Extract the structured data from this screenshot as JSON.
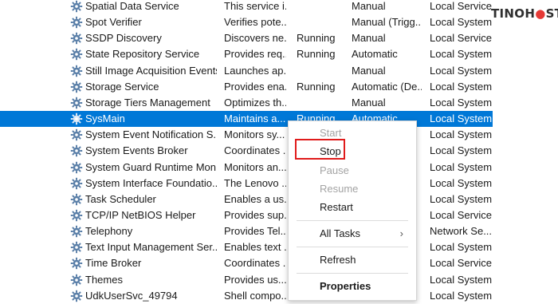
{
  "services": [
    {
      "name": "Spatial Data Service",
      "description": "This service i...",
      "status": "",
      "startup": "Manual",
      "logon": "Local Service"
    },
    {
      "name": "Spot Verifier",
      "description": "Verifies pote...",
      "status": "",
      "startup": "Manual (Trigg...",
      "logon": "Local System"
    },
    {
      "name": "SSDP Discovery",
      "description": "Discovers ne...",
      "status": "Running",
      "startup": "Manual",
      "logon": "Local Service"
    },
    {
      "name": "State Repository Service",
      "description": "Provides req...",
      "status": "Running",
      "startup": "Automatic",
      "logon": "Local System"
    },
    {
      "name": "Still Image Acquisition Events",
      "description": "Launches ap...",
      "status": "",
      "startup": "Manual",
      "logon": "Local System"
    },
    {
      "name": "Storage Service",
      "description": "Provides ena...",
      "status": "Running",
      "startup": "Automatic (De...",
      "logon": "Local System"
    },
    {
      "name": "Storage Tiers Management",
      "description": "Optimizes th...",
      "status": "",
      "startup": "Manual",
      "logon": "Local System"
    },
    {
      "name": "SysMain",
      "description": "Maintains a...",
      "status": "Running",
      "startup": "Automatic",
      "logon": "Local System",
      "selected": true
    },
    {
      "name": "System Event Notification S...",
      "description": "Monitors sy...",
      "status": "",
      "startup": "",
      "logon": "Local System"
    },
    {
      "name": "System Events Broker",
      "description": "Coordinates ...",
      "status": "",
      "startup": "",
      "logon": "Local System"
    },
    {
      "name": "System Guard Runtime Mon...",
      "description": "Monitors an...",
      "status": "",
      "startup": "",
      "logon": "Local System"
    },
    {
      "name": "System Interface Foundatio...",
      "description": "The Lenovo ...",
      "status": "",
      "startup": "",
      "logon": "Local System"
    },
    {
      "name": "Task Scheduler",
      "description": "Enables a us...",
      "status": "",
      "startup": "",
      "logon": "Local System"
    },
    {
      "name": "TCP/IP NetBIOS Helper",
      "description": "Provides sup...",
      "status": "",
      "startup": "",
      "logon": "Local Service"
    },
    {
      "name": "Telephony",
      "description": "Provides Tel...",
      "status": "",
      "startup": "",
      "logon": "Network Se..."
    },
    {
      "name": "Text Input Management Ser...",
      "description": "Enables text ...",
      "status": "",
      "startup": "",
      "logon": "Local System"
    },
    {
      "name": "Time Broker",
      "description": "Coordinates ...",
      "status": "",
      "startup": "",
      "logon": "Local Service"
    },
    {
      "name": "Themes",
      "description": "Provides us...",
      "status": "",
      "startup": "",
      "logon": "Local System"
    },
    {
      "name": "UdkUserSvc_49794",
      "description": "Shell compo...",
      "status": "",
      "startup": "",
      "logon": "Local System"
    }
  ],
  "context_menu": {
    "start": "Start",
    "stop": "Stop",
    "pause": "Pause",
    "resume": "Resume",
    "restart": "Restart",
    "all_tasks": "All Tasks",
    "all_tasks_arrow": "›",
    "refresh": "Refresh",
    "properties": "Properties"
  },
  "brand": {
    "part1": "TINO",
    "part2": "H",
    "part3": "ST"
  },
  "colors": {
    "selection": "#0078d7",
    "highlight_box": "#e01b1b",
    "gear": "#5a7fa8"
  }
}
